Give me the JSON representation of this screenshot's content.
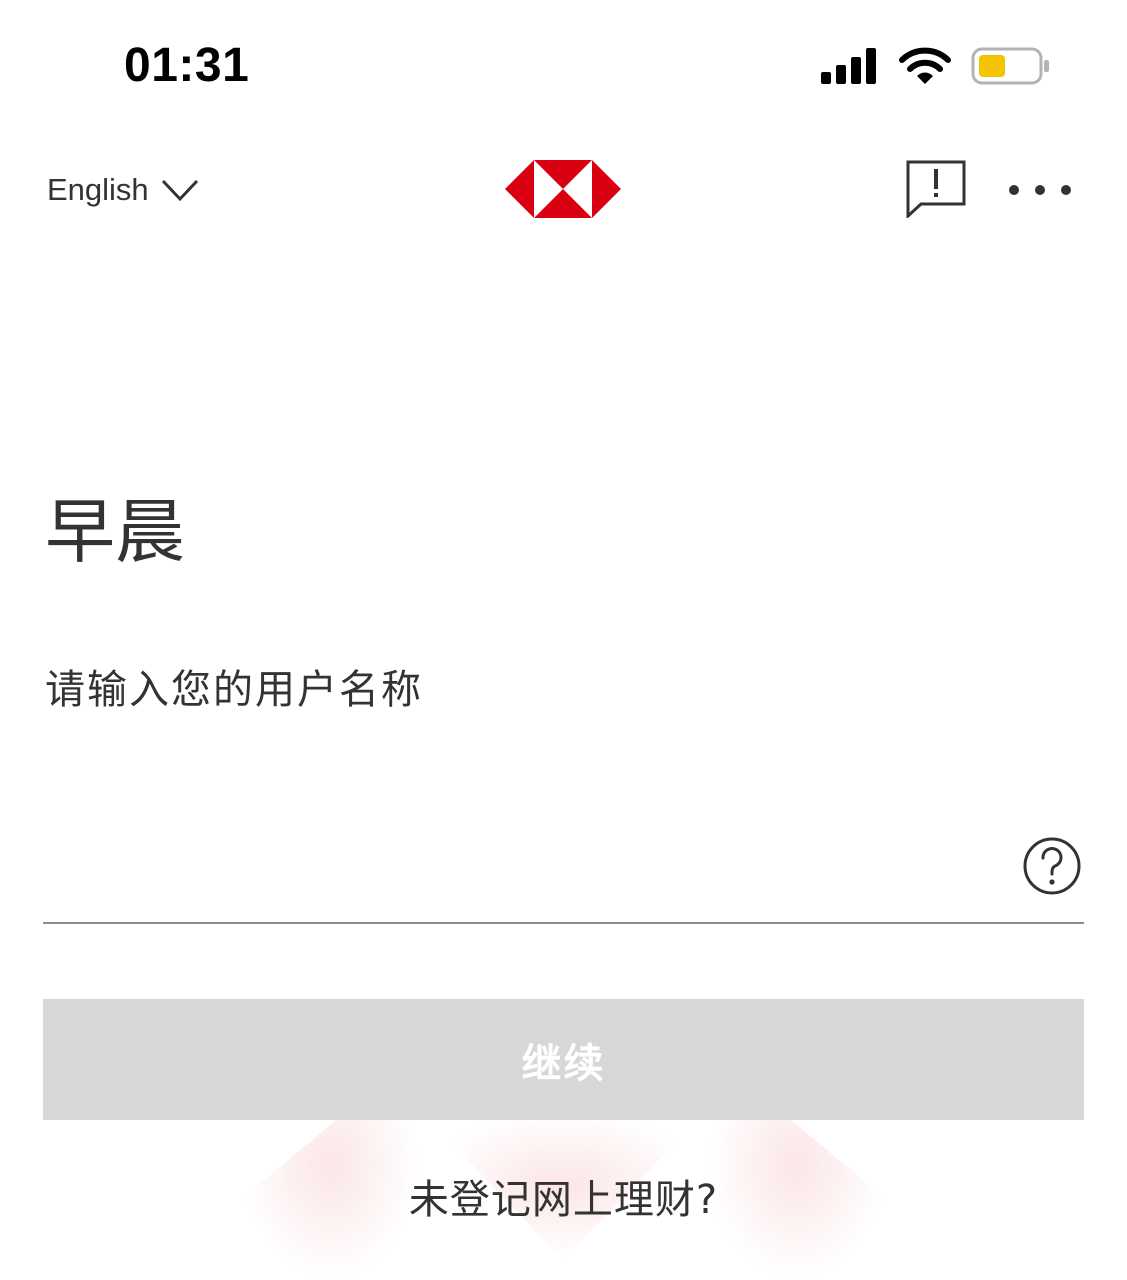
{
  "status_bar": {
    "time": "01:31",
    "icons": [
      "cellular-signal-icon",
      "wifi-icon",
      "battery-icon"
    ],
    "battery_color": "#f5c400"
  },
  "nav": {
    "language": {
      "label": "English",
      "icon": "chevron-down-icon"
    },
    "logo": "hexagon-logo",
    "feedback_icon": "feedback-icon",
    "more_icon": "more-icon"
  },
  "login": {
    "greeting": "早晨",
    "username_label": "请输入您的用户名称",
    "username_value": "",
    "help_icon": "help-icon",
    "continue_label": "继续",
    "register_link": "未登记网上理财?"
  },
  "colors": {
    "brand_red": "#db0011",
    "text": "#333333",
    "button_disabled": "#d7d8d6",
    "underline": "#8c8c8c"
  }
}
